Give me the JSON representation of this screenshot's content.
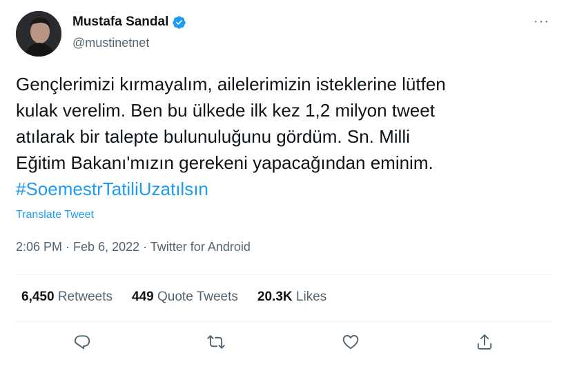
{
  "author": {
    "name": "Mustafa Sandal",
    "handle": "@mustinetnet",
    "verified_icon": "verified-badge-icon",
    "more_icon": "more-icon",
    "more_symbol": "···"
  },
  "tweet": {
    "lines": [
      "Gençlerimizi kırmayalım, ailelerimizin isteklerine lütfen",
      "kulak verelim. Ben bu ülkede ilk kez 1,2 milyon tweet",
      "atılarak bir talepte bulunuluğunu gördüm. Sn. Milli",
      "Eğitim Bakanı'mızın gerekeni yapacağından eminim."
    ],
    "hashtag": "#SoemestrTatiliUzatılsın",
    "translate_label": "Translate Tweet"
  },
  "meta": {
    "time": "2:06 PM",
    "separator1": " · ",
    "date": "Feb 6, 2022",
    "separator2": " · ",
    "source": "Twitter for Android"
  },
  "stats": {
    "retweets_count": "6,450",
    "retweets_label": "Retweets",
    "quotes_count": "449",
    "quotes_label": "Quote Tweets",
    "likes_count": "20.3K",
    "likes_label": "Likes"
  },
  "actions": [
    {
      "name": "reply",
      "icon": "reply-icon"
    },
    {
      "name": "retweet",
      "icon": "retweet-icon"
    },
    {
      "name": "like",
      "icon": "heart-icon"
    },
    {
      "name": "share",
      "icon": "share-icon"
    }
  ],
  "colors": {
    "accent": "#1d9bf0",
    "text_primary": "#0f1419",
    "text_secondary": "#536471",
    "divider": "#eff3f4"
  }
}
